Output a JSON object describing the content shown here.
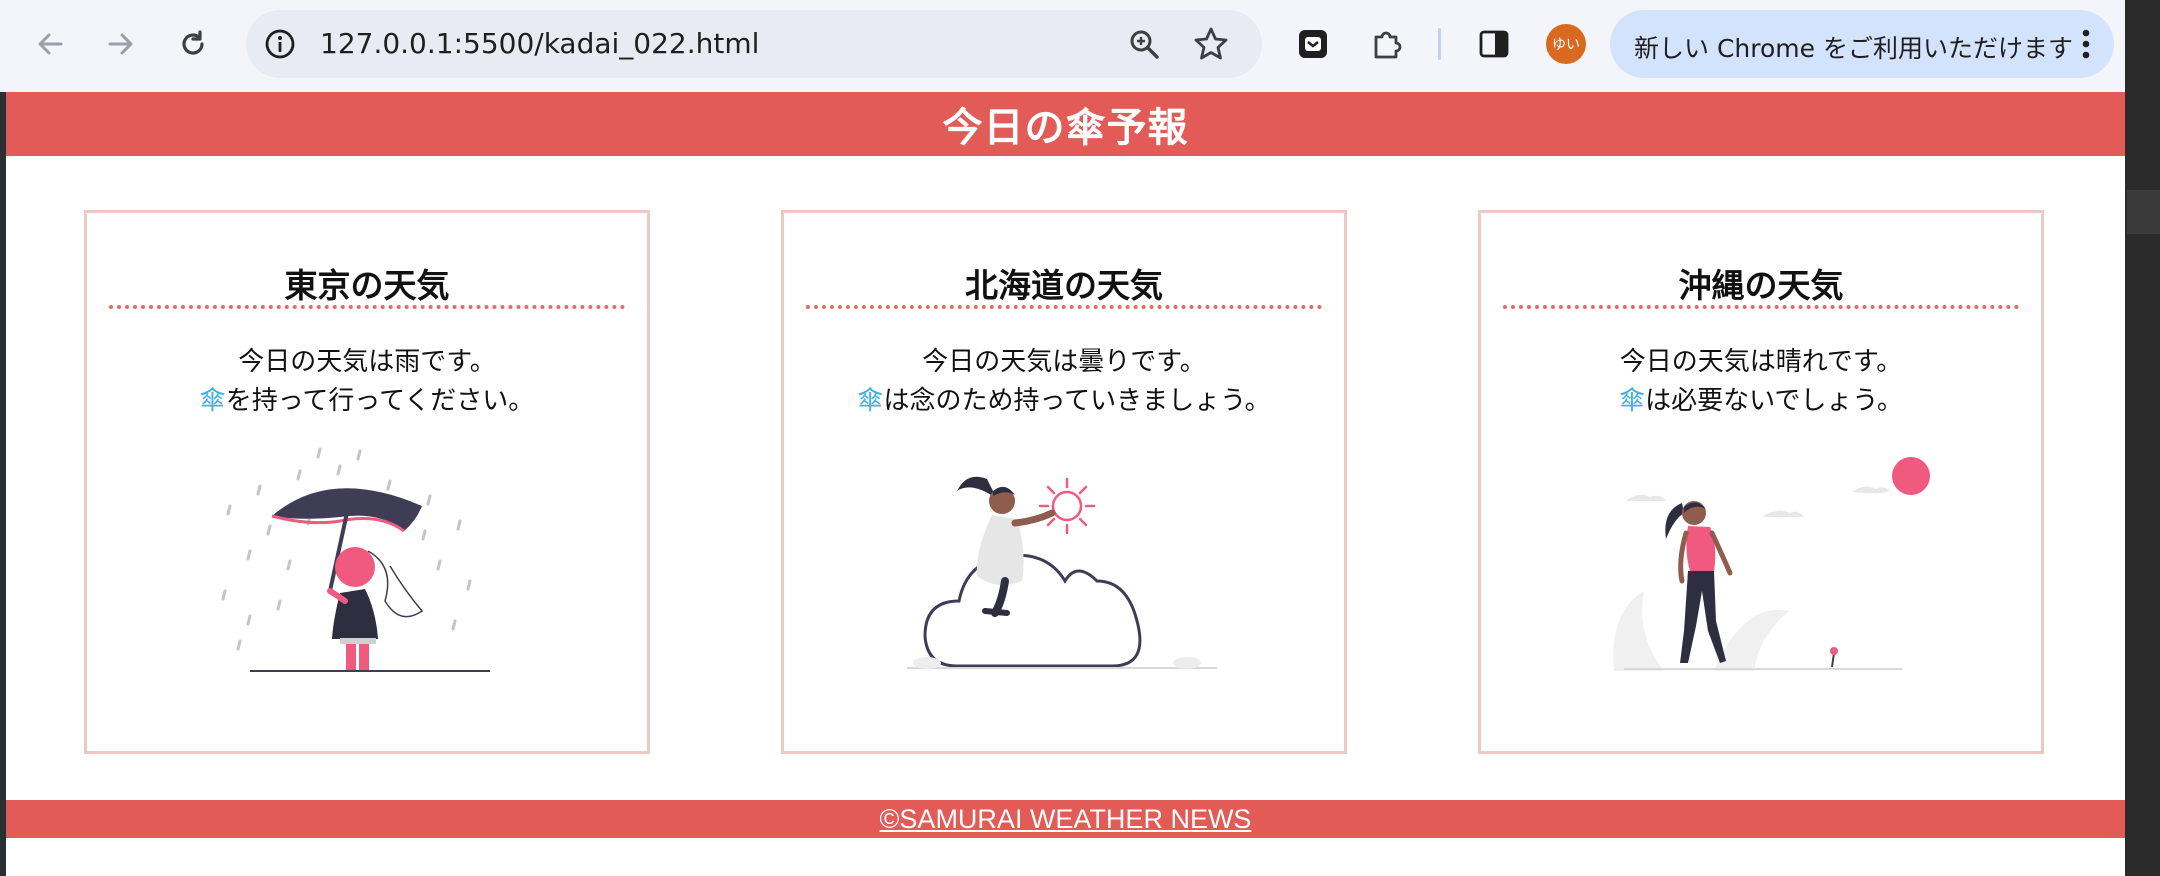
{
  "browser": {
    "url": "127.0.0.1:5500/kadai_022.html",
    "profile_initials": "ゆい",
    "update_label": "新しい Chrome をご利用いただけます",
    "avatar_color": "#d9691f"
  },
  "page": {
    "title": "今日の傘予報",
    "accent_color": "#e25b57",
    "cards": [
      {
        "title": "東京の天気",
        "line1": "今日の天気は雨です。",
        "icon": "傘",
        "line2": "を持って行ってください。",
        "illustration": "rain-umbrella-illustration"
      },
      {
        "title": "北海道の天気",
        "line1": "今日の天気は曇りです。",
        "icon": "傘",
        "line2": "は念のため持っていきましょう。",
        "illustration": "cloud-sun-illustration"
      },
      {
        "title": "沖縄の天気",
        "line1": "今日の天気は晴れです。",
        "icon": "傘",
        "line2": "は必要ないでしょう。",
        "illustration": "sunny-walk-illustration"
      }
    ],
    "footer": "©SAMURAI WEATHER NEWS"
  }
}
